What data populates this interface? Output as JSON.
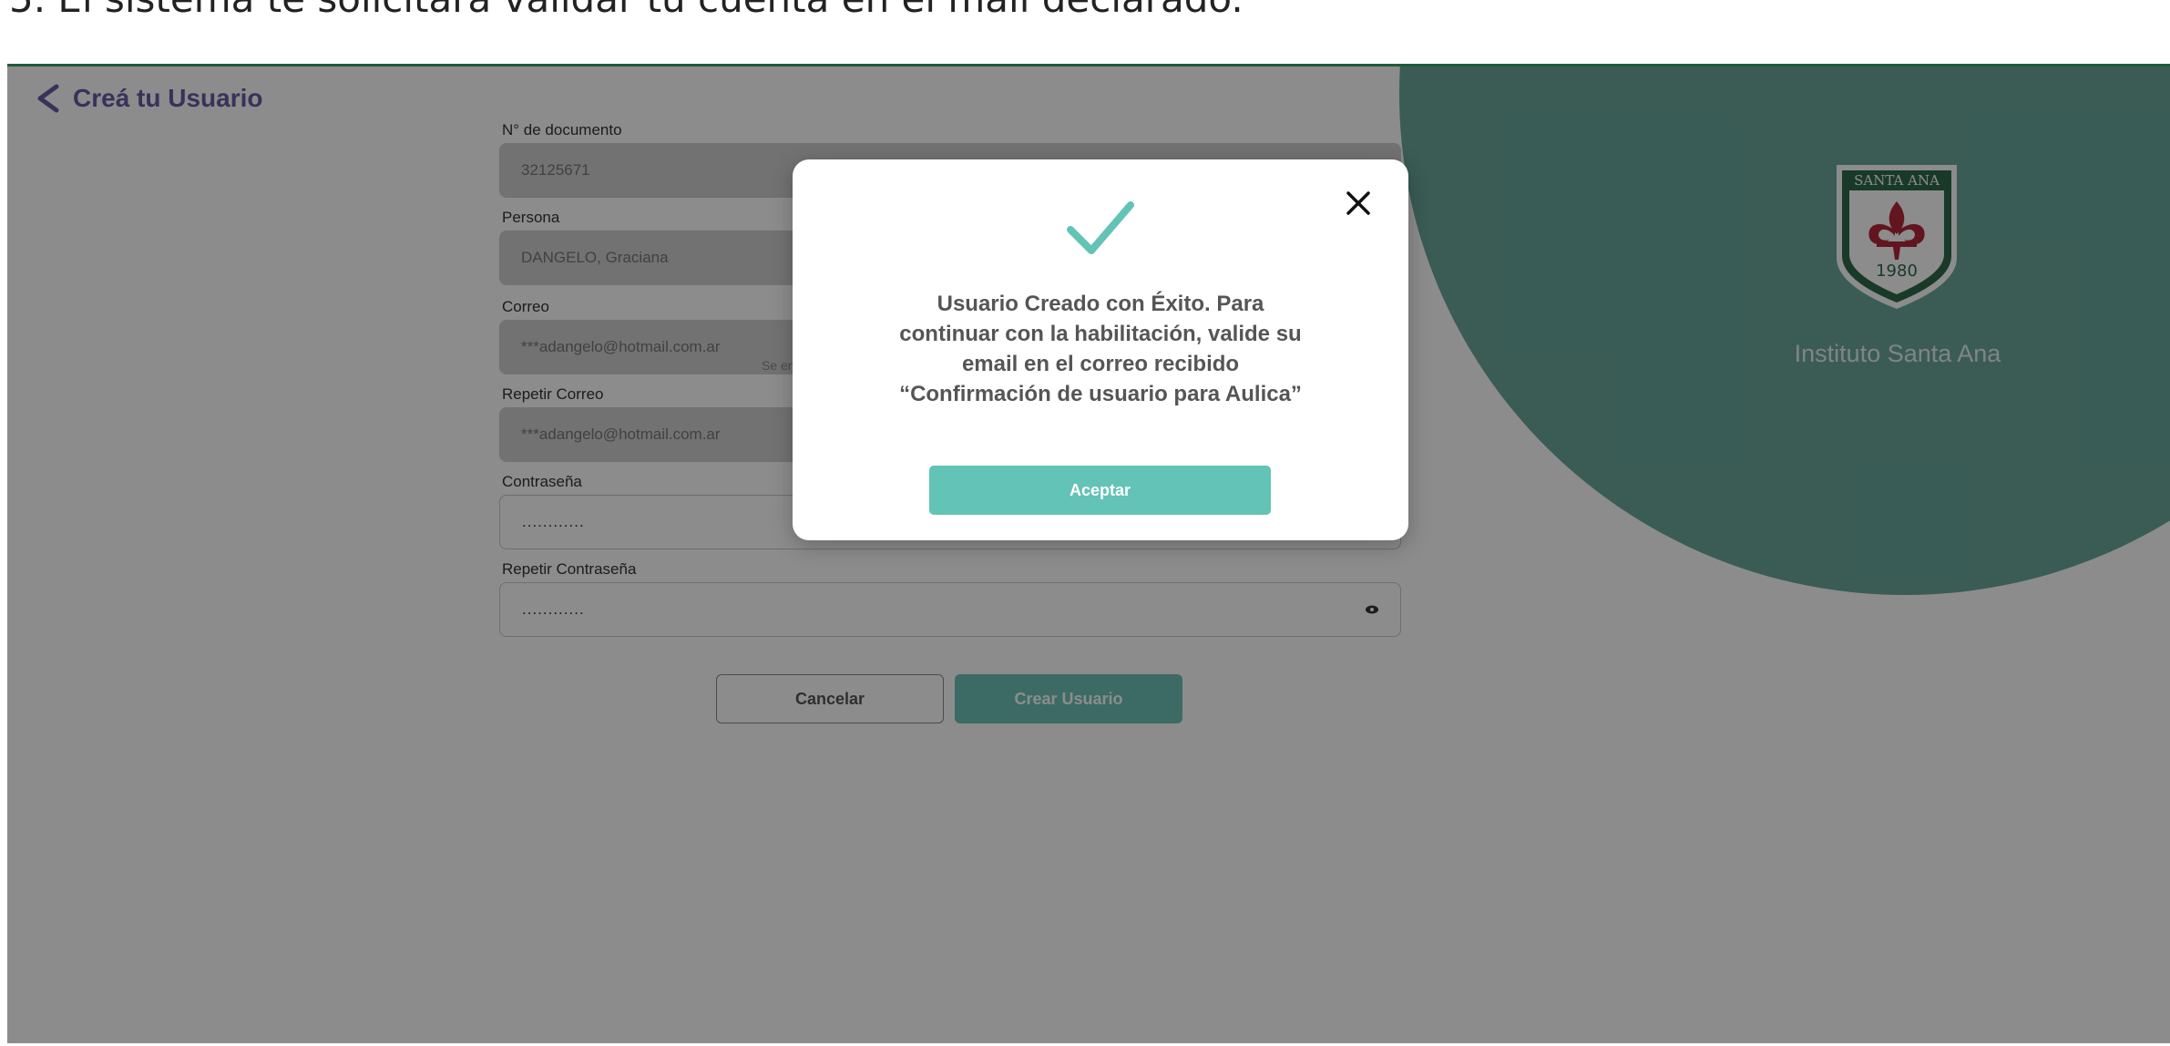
{
  "instruction": "5.   El sistema te solicitará validar tu cuenta en el mail declarado.",
  "header": {
    "back_label": "Creá tu Usuario"
  },
  "brand": {
    "institute_name": "Instituto Santa Ana",
    "logo_top_text": "SANTA ANA",
    "logo_year": "1980"
  },
  "form": {
    "document": {
      "label": "N° de documento",
      "value": "32125671"
    },
    "person": {
      "label": "Persona",
      "value": "DANGELO, Graciana"
    },
    "hint": "Se en",
    "email": {
      "label": "Correo",
      "value": "***adangelo@hotmail.com.ar"
    },
    "email_repeat": {
      "label": "Repetir Correo",
      "value": "***adangelo@hotmail.com.ar"
    },
    "password": {
      "label": "Contraseña",
      "value": "............"
    },
    "password_repeat": {
      "label": "Repetir Contraseña",
      "value": "............"
    },
    "cancel_label": "Cancelar",
    "create_label": "Crear Usuario"
  },
  "modal": {
    "message": "Usuario Creado con Éxito. Para continuar con la habilitación, valide su email en el correo recibido “Confirmación de usuario para Aulica”",
    "accept_label": "Aceptar"
  },
  "icons": {
    "back": "chevron-left-icon",
    "eye": "eye-icon",
    "close": "close-icon",
    "check": "check-icon"
  },
  "colors": {
    "accent": "#62c3b6",
    "circle": "#6aa89c",
    "back_link": "#6a5aa6",
    "logo_green": "#2f6b4b",
    "logo_red": "#b3263a"
  }
}
